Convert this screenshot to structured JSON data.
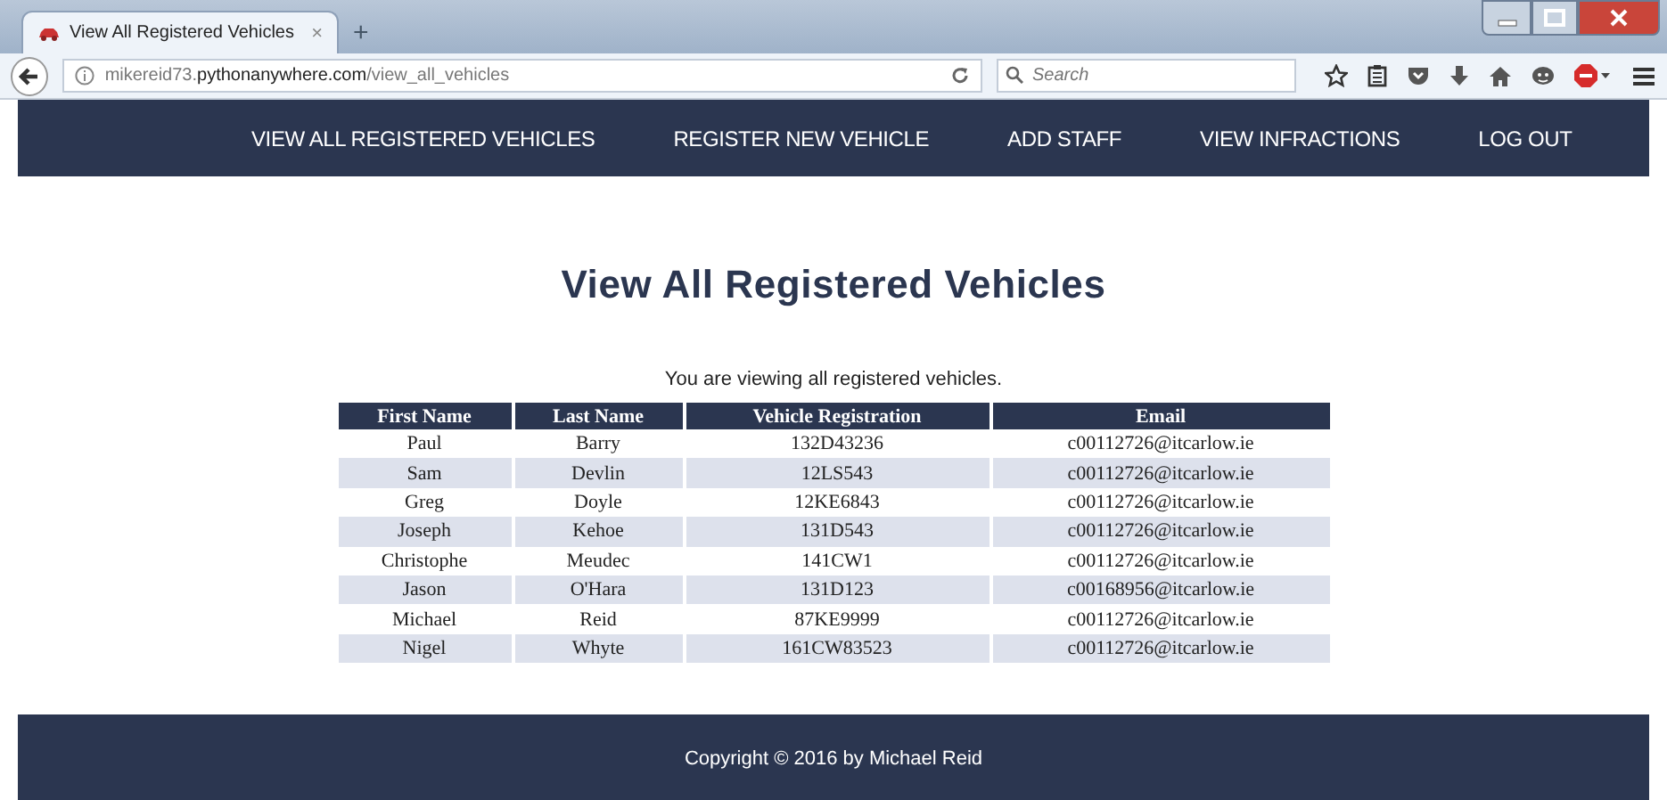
{
  "browser": {
    "tabs": [
      {
        "title": "View All Registered Vehicles",
        "close": "×",
        "selected": true
      }
    ],
    "new_tab": "+",
    "url": "mikereid73.**pythonanywhere.com**/view_all_vehicles",
    "search": {
      "placeholder": "Search"
    }
  },
  "nav": {
    "items": [
      "VIEW ALL REGISTERED VEHICLES",
      "REGISTER NEW VEHICLE",
      "ADD STAFF",
      "VIEW INFRACTIONS",
      "LOG OUT"
    ]
  },
  "page": {
    "title": "View All Registered Vehicles",
    "intro": "You are viewing all registered vehicles."
  },
  "table": {
    "columns": [
      "First Name",
      "Last Name",
      "Vehicle Registration",
      "Email"
    ],
    "rows": [
      [
        "Paul",
        "Barry",
        "132D43236",
        "c00112726@itcarlow.ie"
      ],
      [
        "Sam",
        "Devlin",
        "12LS543",
        "c00112726@itcarlow.ie"
      ],
      [
        "Greg",
        "Doyle",
        "12KE6843",
        "c00112726@itcarlow.ie"
      ],
      [
        "Joseph",
        "Kehoe",
        "131D543",
        "c00112726@itcarlow.ie"
      ],
      [
        "Christophe",
        "Meudec",
        "141CW1",
        "c00112726@itcarlow.ie"
      ],
      [
        "Jason",
        "O'Hara",
        "131D123",
        "c00168956@itcarlow.ie"
      ],
      [
        "Michael",
        "Reid",
        "87KE9999",
        "c00112726@itcarlow.ie"
      ],
      [
        "Nigel",
        "Whyte",
        "161CW83523",
        "c00112726@itcarlow.ie"
      ]
    ]
  },
  "footer": {
    "text": "Copyright © 2016 by Michael Reid"
  }
}
